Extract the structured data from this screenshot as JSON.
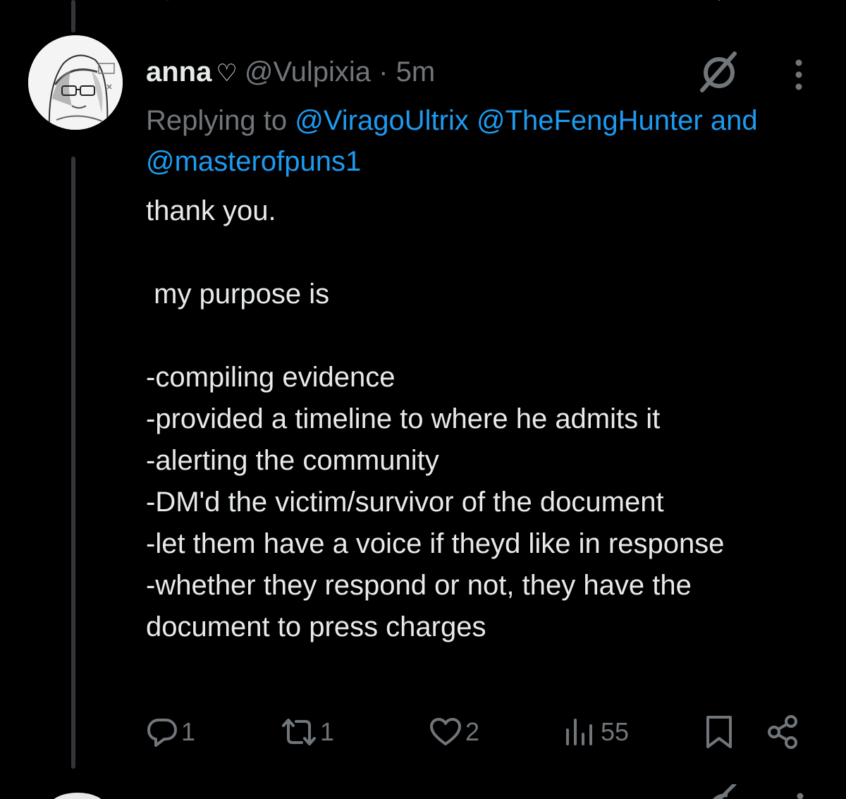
{
  "previous_tweet": {
    "visible_counts_partial": true
  },
  "tweet": {
    "display_name": "anna",
    "badge_symbol": "♡",
    "handle": "@Vulpixia",
    "separator": "·",
    "time": "5m",
    "replying_to_label": "Replying to ",
    "mentions": [
      "@ViragoUltrix",
      "@TheFengHunter",
      "@masterofpuns1"
    ],
    "mention_joiner": "and",
    "text": "thank you.\n\n my purpose is\n\n-compiling evidence\n-provided a timeline to where he admits it\n-alerting the community\n-DM'd the victim/survivor of the document\n-let them have a voice if theyd like in response\n-whether they respond or not, they have the document to press charges",
    "actions": {
      "replies": "1",
      "retweets": "1",
      "likes": "2",
      "views": "55"
    }
  },
  "icons": {
    "reply": "reply-icon",
    "retweet": "retweet-icon",
    "like": "heart-icon",
    "views": "views-icon",
    "bookmark": "bookmark-icon",
    "share": "share-icon",
    "grok": "grok-icon",
    "more": "more-icon"
  },
  "colors": {
    "background": "#000000",
    "text_primary": "#e7e9ea",
    "text_secondary": "#71767b",
    "link": "#1d9bf0",
    "thread_line": "#333639",
    "like_accent": "#f91880"
  }
}
